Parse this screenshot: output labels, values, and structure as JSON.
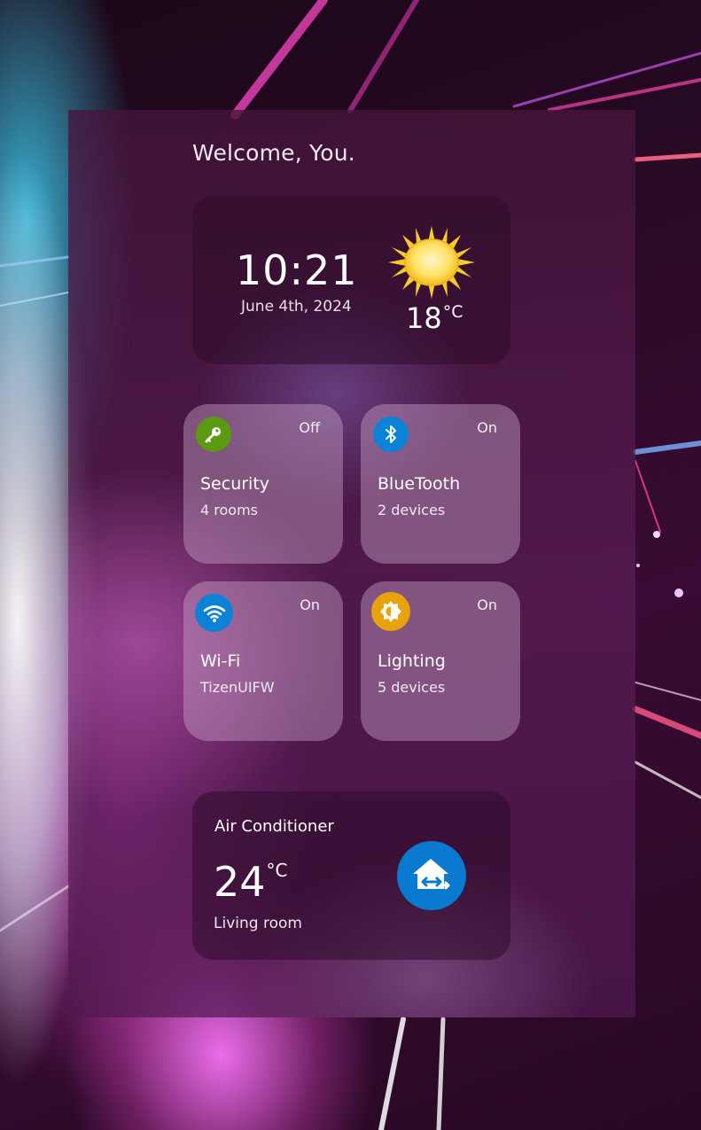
{
  "greeting": "Welcome, You.",
  "clock": {
    "time": "10:21",
    "date": "June 4th, 2024",
    "weather_icon": "sun-icon",
    "temperature": "18",
    "unit": "°C"
  },
  "tiles": [
    {
      "title": "Security",
      "subtitle": "4 rooms",
      "status": "Off",
      "icon": "key-icon",
      "icon_color": "#5a9a12"
    },
    {
      "title": "BlueTooth",
      "subtitle": "2 devices",
      "status": "On",
      "icon": "bluetooth-icon",
      "icon_color": "#0b82d6"
    },
    {
      "title": "Wi-Fi",
      "subtitle": "TizenUIFW",
      "status": "On",
      "icon": "wifi-icon",
      "icon_color": "#0b82d6"
    },
    {
      "title": "Lighting",
      "subtitle": "5 devices",
      "status": "On",
      "icon": "brightness-icon",
      "icon_color": "#e9a20a"
    }
  ],
  "air_conditioner": {
    "title": "Air Conditioner",
    "temperature": "24",
    "unit": "°C",
    "room": "Living room",
    "button_icon": "home-swap-icon",
    "button_color": "#0a7ad1"
  }
}
